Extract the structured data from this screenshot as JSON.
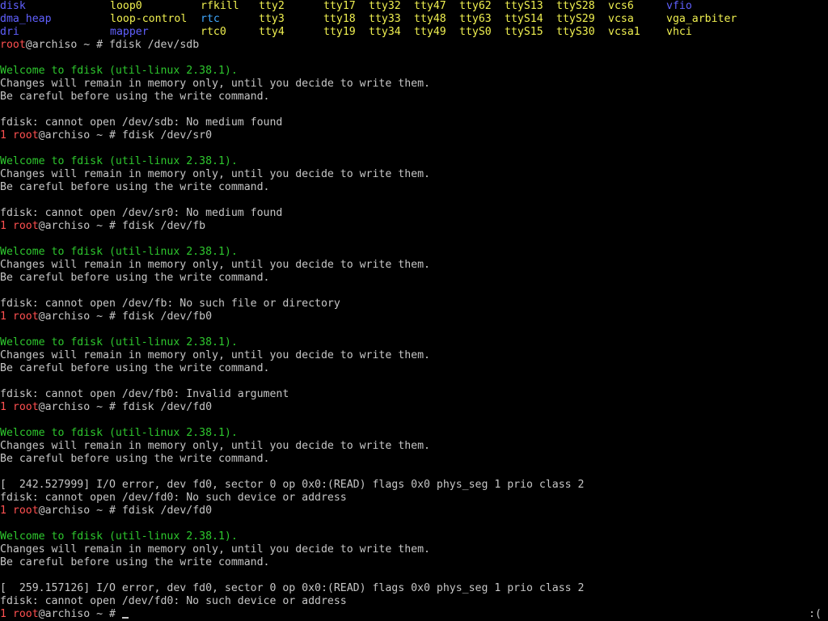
{
  "colors": {
    "background": "#000000",
    "text": "#c6c6c6",
    "directory_entry": "#6060ff",
    "device_entry": "#f0f050",
    "symlink_entry": "#40a8ff",
    "welcome": "#2ec82e",
    "prompt_user_and_exit_code": "#ff5050"
  },
  "device_listing": {
    "rows": [
      [
        {
          "text": "disk",
          "kind": "dir"
        },
        {
          "text": "loop0",
          "kind": "dev"
        },
        {
          "text": "rfkill",
          "kind": "dev"
        },
        {
          "text": "tty2",
          "kind": "dev"
        },
        {
          "text": "tty17",
          "kind": "dev"
        },
        {
          "text": "tty32",
          "kind": "dev"
        },
        {
          "text": "tty47",
          "kind": "dev"
        },
        {
          "text": "tty62",
          "kind": "dev"
        },
        {
          "text": "ttyS13",
          "kind": "dev"
        },
        {
          "text": "ttyS28",
          "kind": "dev"
        },
        {
          "text": "vcs6",
          "kind": "dev"
        },
        {
          "text": "vfio",
          "kind": "dir"
        }
      ],
      [
        {
          "text": "dma_heap",
          "kind": "dir"
        },
        {
          "text": "loop-control",
          "kind": "dev"
        },
        {
          "text": "rtc",
          "kind": "link"
        },
        {
          "text": "tty3",
          "kind": "dev"
        },
        {
          "text": "tty18",
          "kind": "dev"
        },
        {
          "text": "tty33",
          "kind": "dev"
        },
        {
          "text": "tty48",
          "kind": "dev"
        },
        {
          "text": "tty63",
          "kind": "dev"
        },
        {
          "text": "ttyS14",
          "kind": "dev"
        },
        {
          "text": "ttyS29",
          "kind": "dev"
        },
        {
          "text": "vcsa",
          "kind": "dev"
        },
        {
          "text": "vga_arbiter",
          "kind": "dev"
        }
      ],
      [
        {
          "text": "dri",
          "kind": "dir"
        },
        {
          "text": "mapper",
          "kind": "dir"
        },
        {
          "text": "rtc0",
          "kind": "dev"
        },
        {
          "text": "tty4",
          "kind": "dev"
        },
        {
          "text": "tty19",
          "kind": "dev"
        },
        {
          "text": "tty34",
          "kind": "dev"
        },
        {
          "text": "tty49",
          "kind": "dev"
        },
        {
          "text": "ttyS0",
          "kind": "dev"
        },
        {
          "text": "ttyS15",
          "kind": "dev"
        },
        {
          "text": "ttyS30",
          "kind": "dev"
        },
        {
          "text": "vcsa1",
          "kind": "dev"
        },
        {
          "text": "vhci",
          "kind": "dev"
        }
      ]
    ]
  },
  "welcome_block": {
    "welcome": "Welcome to fdisk (util-linux 2.38.1).",
    "memory_note": "Changes will remain in memory only, until you decide to write them.",
    "careful_note": "Be careful before using the write command."
  },
  "prompt": {
    "user": "root",
    "host_and_path": "@archiso ~ # "
  },
  "sessions": [
    {
      "exit_code": "",
      "command": "fdisk /dev/sdb",
      "kernel_message": "",
      "error": "fdisk: cannot open /dev/sdb: No medium found"
    },
    {
      "exit_code": "1",
      "command": "fdisk /dev/sr0",
      "kernel_message": "",
      "error": "fdisk: cannot open /dev/sr0: No medium found"
    },
    {
      "exit_code": "1",
      "command": "fdisk /dev/fb",
      "kernel_message": "",
      "error": "fdisk: cannot open /dev/fb: No such file or directory"
    },
    {
      "exit_code": "1",
      "command": "fdisk /dev/fb0",
      "kernel_message": "",
      "error": "fdisk: cannot open /dev/fb0: Invalid argument"
    },
    {
      "exit_code": "1",
      "command": "fdisk /dev/fd0",
      "kernel_message": "[  242.527999] I/O error, dev fd0, sector 0 op 0x0:(READ) flags 0x0 phys_seg 1 prio class 2",
      "error": "fdisk: cannot open /dev/fd0: No such device or address"
    },
    {
      "exit_code": "1",
      "command": "fdisk /dev/fd0",
      "kernel_message": "[  259.157126] I/O error, dev fd0, sector 0 op 0x0:(READ) flags 0x0 phys_seg 1 prio class 2",
      "error": "fdisk: cannot open /dev/fd0: No such device or address"
    }
  ],
  "final_prompt": {
    "exit_code": "1",
    "input": ""
  },
  "corner_indicator": ":("
}
